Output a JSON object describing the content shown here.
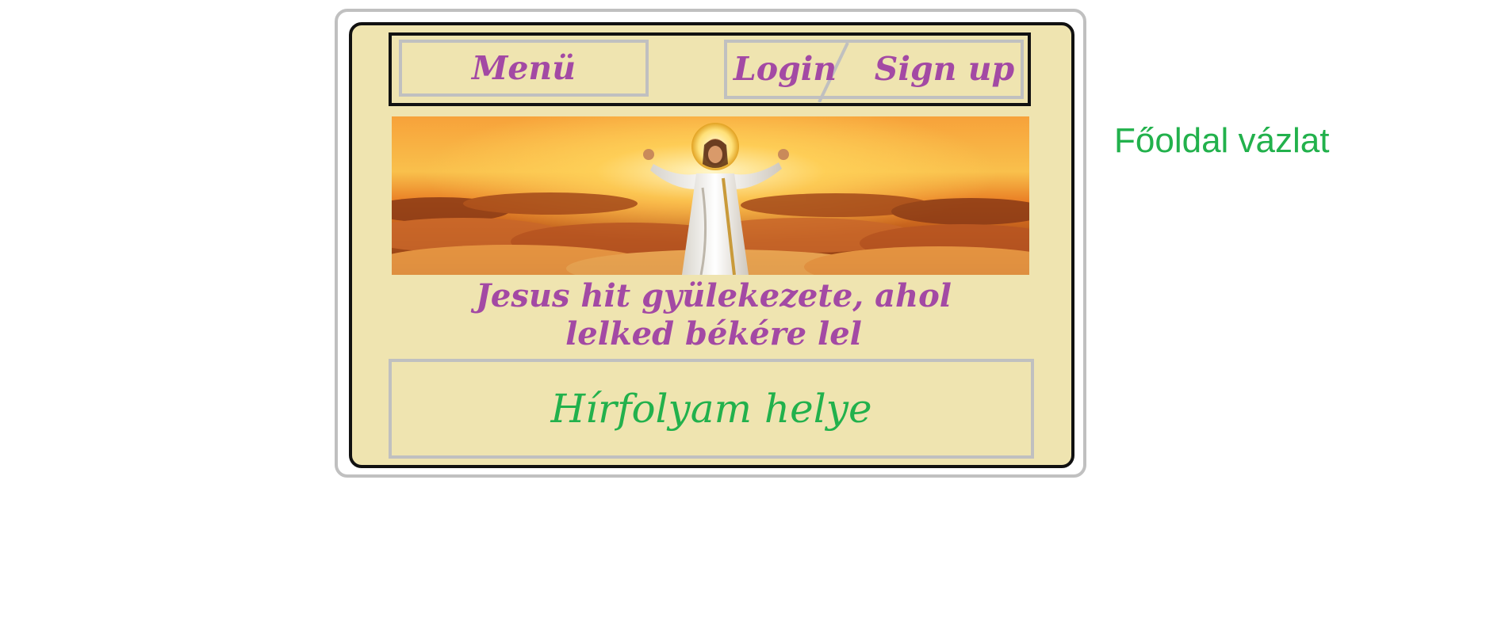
{
  "sketch_title": "Főoldal vázlat",
  "nav": {
    "menu_label": "Menü",
    "login_label": "Login",
    "signup_label": "Sign up"
  },
  "hero": {
    "image_subject": "jesus-above-clouds"
  },
  "tagline": {
    "line1": "Jesus hit gyülekezete, ahol",
    "line2": "lelked békére lel"
  },
  "news_feed": {
    "placeholder_label": "Hírfolyam helye"
  },
  "colors": {
    "page_background": "#efe4b0",
    "accent_purple": "#a349a4",
    "note_green": "#22b14c",
    "border_gray": "#c0c0c0",
    "border_dark": "#111111"
  }
}
